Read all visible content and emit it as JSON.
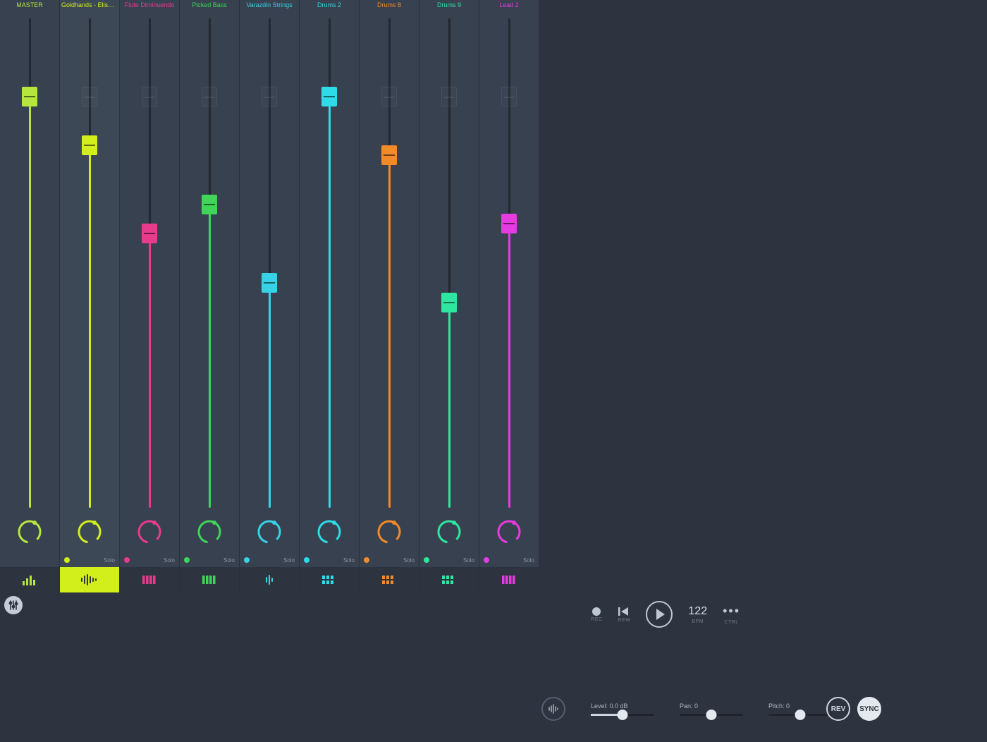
{
  "channels": [
    {
      "name": "MASTER",
      "color": "#b6e63e",
      "fader": 0.84,
      "isMaster": true,
      "icon": "bars",
      "highlight": false
    },
    {
      "name": "Goldhands - Elisa (...ocal)",
      "color": "#d2ef1b",
      "fader": 0.74,
      "ghost": 0.84,
      "icon": "wave",
      "highlight": true
    },
    {
      "name": "Flute Diminuendo",
      "color": "#e83b8e",
      "fader": 0.56,
      "ghost": 0.84,
      "icon": "keys",
      "highlight": false
    },
    {
      "name": "Picked Bass",
      "color": "#3fd559",
      "fader": 0.62,
      "ghost": 0.84,
      "icon": "keys",
      "highlight": false
    },
    {
      "name": "Varazdin Strings",
      "color": "#38d2e6",
      "fader": 0.46,
      "ghost": 0.84,
      "icon": "wave-small",
      "highlight": false
    },
    {
      "name": "Drums 2",
      "color": "#2edbe6",
      "fader": 0.84,
      "icon": "pads",
      "highlight": false
    },
    {
      "name": "Drums 8",
      "color": "#f28a2a",
      "fader": 0.72,
      "ghost": 0.84,
      "icon": "pads",
      "highlight": false
    },
    {
      "name": "Drums 9",
      "color": "#2fe6a0",
      "fader": 0.42,
      "ghost": 0.84,
      "icon": "pads",
      "highlight": false
    },
    {
      "name": "Lead 2",
      "color": "#e63be0",
      "fader": 0.58,
      "ghost": 0.84,
      "icon": "keys",
      "highlight": false
    }
  ],
  "soloLabel": "Solo",
  "transport": {
    "rec": "REC",
    "rew": "REW",
    "bpm": "122",
    "bpmLabel": "BPM",
    "ctrl": "CTRL"
  },
  "controls": {
    "levelLabel": "Level: 0.0 dB",
    "levelPos": 0.5,
    "panLabel": "Pan: 0",
    "panPos": 0.5,
    "pitchLabel": "Pitch: 0",
    "pitchPos": 0.5,
    "rev": "REV",
    "sync": "SYNC"
  }
}
